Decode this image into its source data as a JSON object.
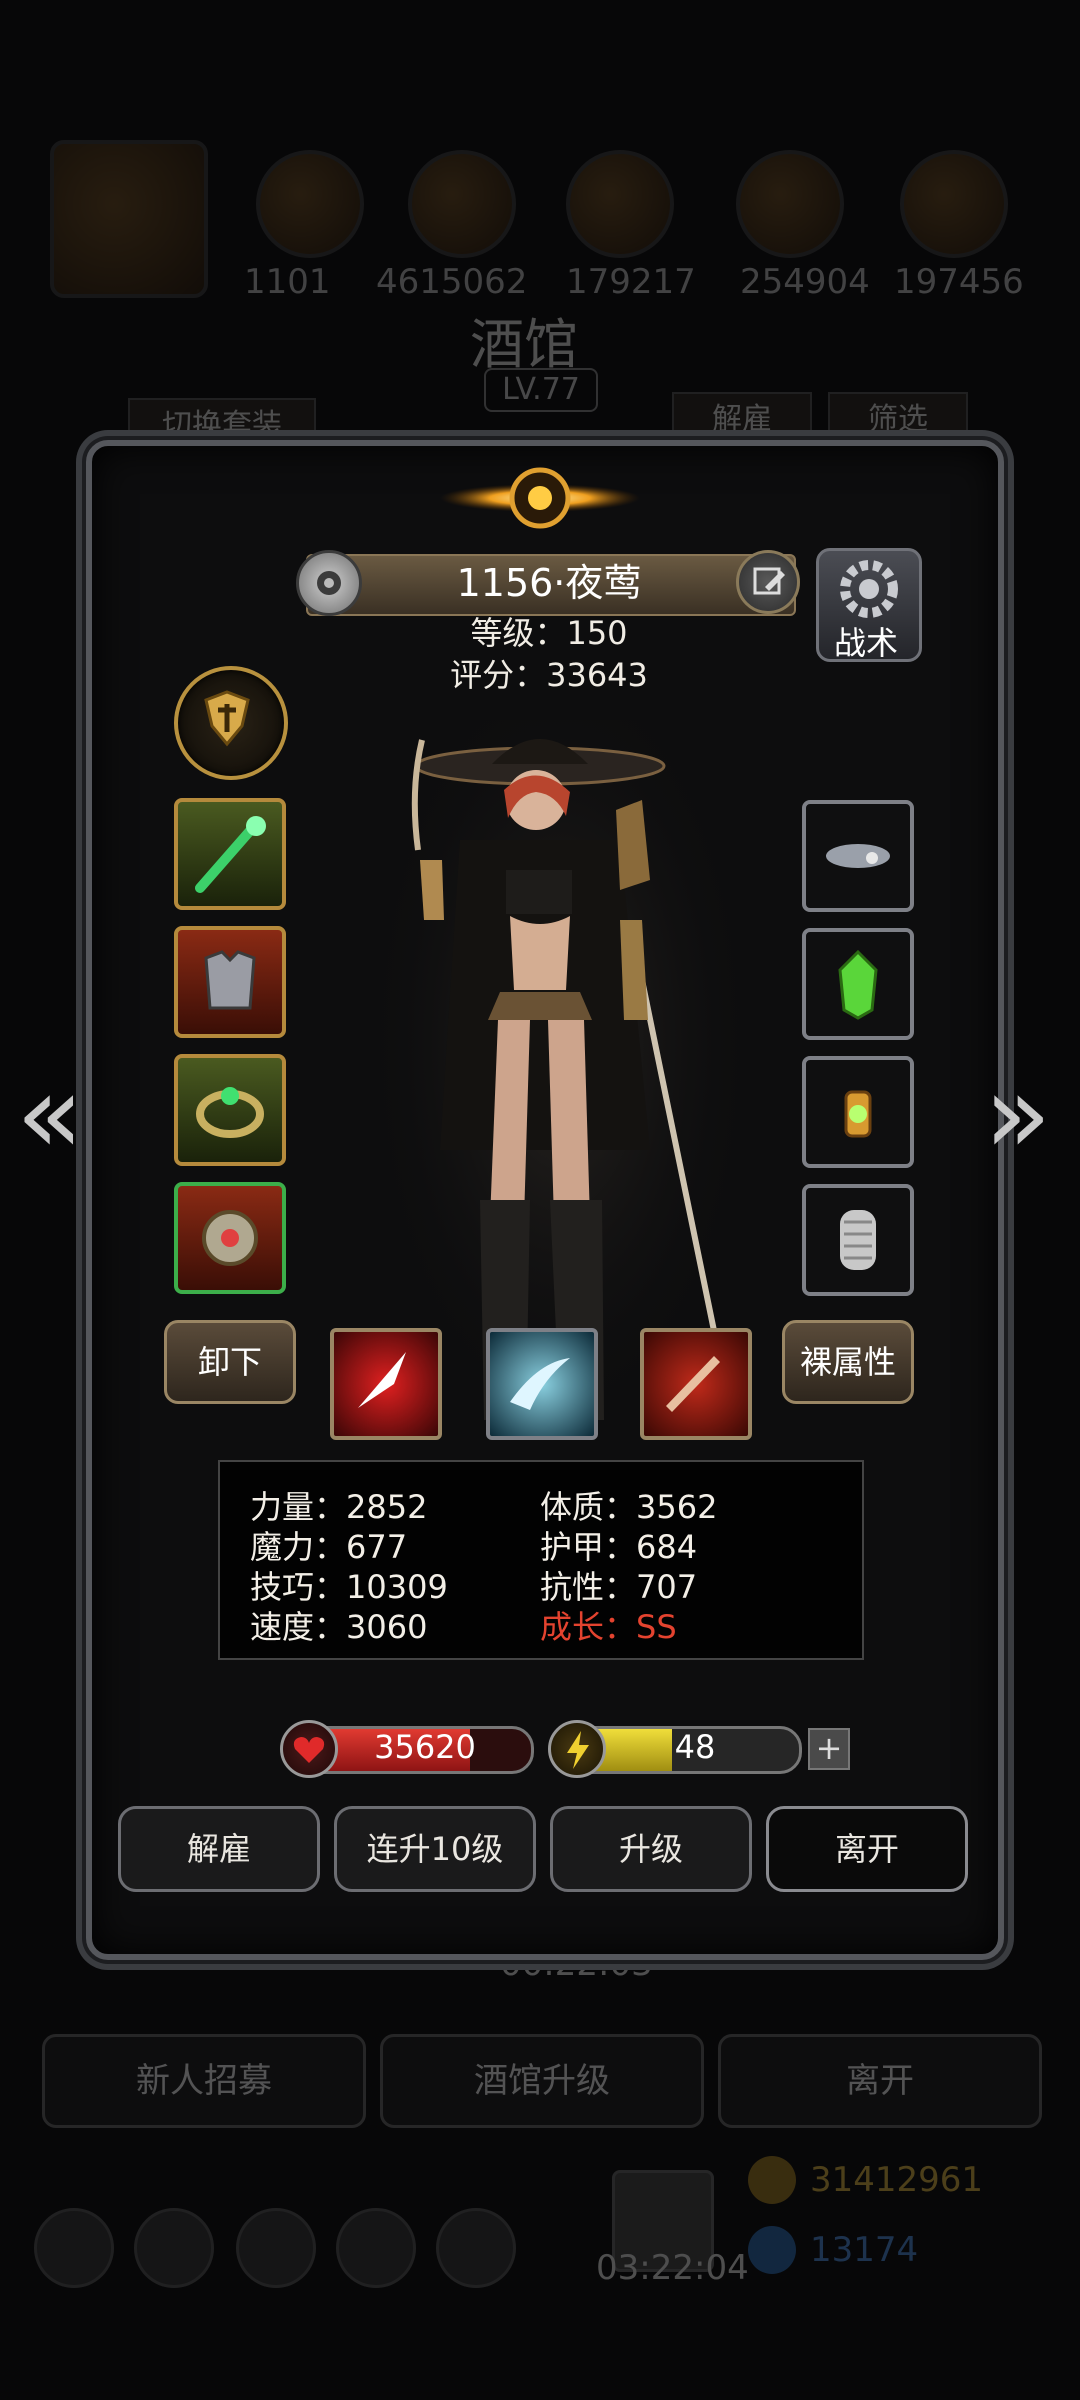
{
  "background": {
    "numbers": [
      "1101",
      "4615062",
      "179217",
      "254904",
      "197456"
    ],
    "title": "酒馆",
    "level": "LV.77",
    "switch_outfit": "切换套装",
    "dismiss": "解雇",
    "filter": "筛选",
    "timer_small": "00:22:03",
    "bottom_buttons": [
      "新人招募",
      "酒馆升级",
      "离开"
    ],
    "timer_bottom": "03:22:04",
    "gold": "31412961",
    "gems": "13174"
  },
  "hero": {
    "name": "1156·夜莺",
    "level_line": "等级：150",
    "score_line": "评分：33643",
    "tactics_label": "战术"
  },
  "buttons": {
    "unequip": "卸下",
    "base_attrs": "裸属性"
  },
  "stats": {
    "strength": "力量：2852",
    "constitution": "体质：3562",
    "magic": "魔力：677",
    "armor": "护甲：684",
    "skill": "技巧：10309",
    "resistance": "抗性：707",
    "speed": "速度：3060",
    "growth": "成长：SS"
  },
  "bars": {
    "hp": "35620",
    "hp_fill": 0.75,
    "energy": "48",
    "energy_fill": 0.48,
    "plus": "+"
  },
  "actions": [
    "解雇",
    "连升10级",
    "升级",
    "离开"
  ],
  "nav": {
    "prev": "«",
    "next": "»"
  },
  "colors": {
    "growth": "#e4432f",
    "hp": "#d42b2b",
    "energy": "#e6d332",
    "gold_frame": "#b58a3c"
  }
}
